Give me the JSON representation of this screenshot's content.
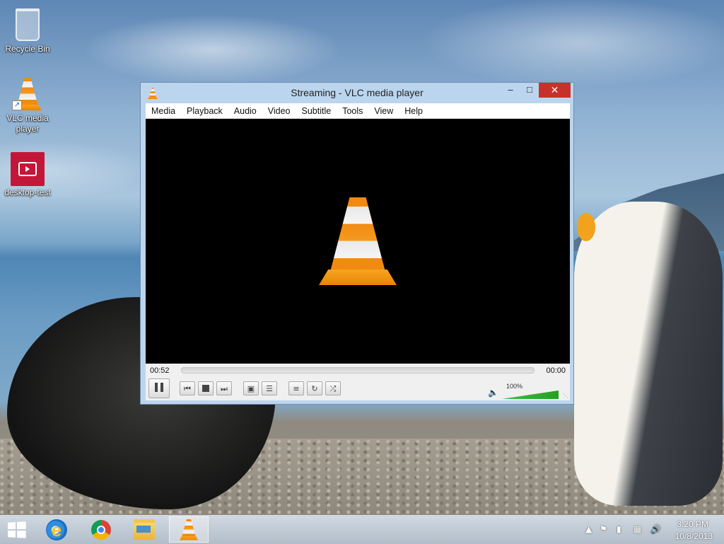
{
  "desktop": {
    "icons": [
      {
        "label": "Recycle Bin",
        "icon": "recycle-bin-icon"
      },
      {
        "label": "VLC media player",
        "icon": "vlc-icon"
      },
      {
        "label": "desktop-test",
        "icon": "desktop-test-icon"
      }
    ]
  },
  "window": {
    "title": "Streaming - VLC media player",
    "buttons": {
      "minimize": "–",
      "maximize": "□",
      "close": "✕"
    },
    "menu": [
      "Media",
      "Playback",
      "Audio",
      "Video",
      "Subtitle",
      "Tools",
      "View",
      "Help"
    ],
    "player": {
      "elapsed": "00:52",
      "total": "00:00",
      "progress": 0,
      "volume_label": "100%",
      "volume_level": 1.0,
      "accent": "#f18a12",
      "volume_color": "#22a022"
    }
  },
  "taskbar": {
    "apps": [
      "internet-explorer-icon",
      "chrome-icon",
      "file-explorer-icon",
      "vlc-icon"
    ],
    "active_app": "vlc-icon",
    "clock": {
      "time": "3:20 PM",
      "date": "10/8/2013"
    }
  }
}
